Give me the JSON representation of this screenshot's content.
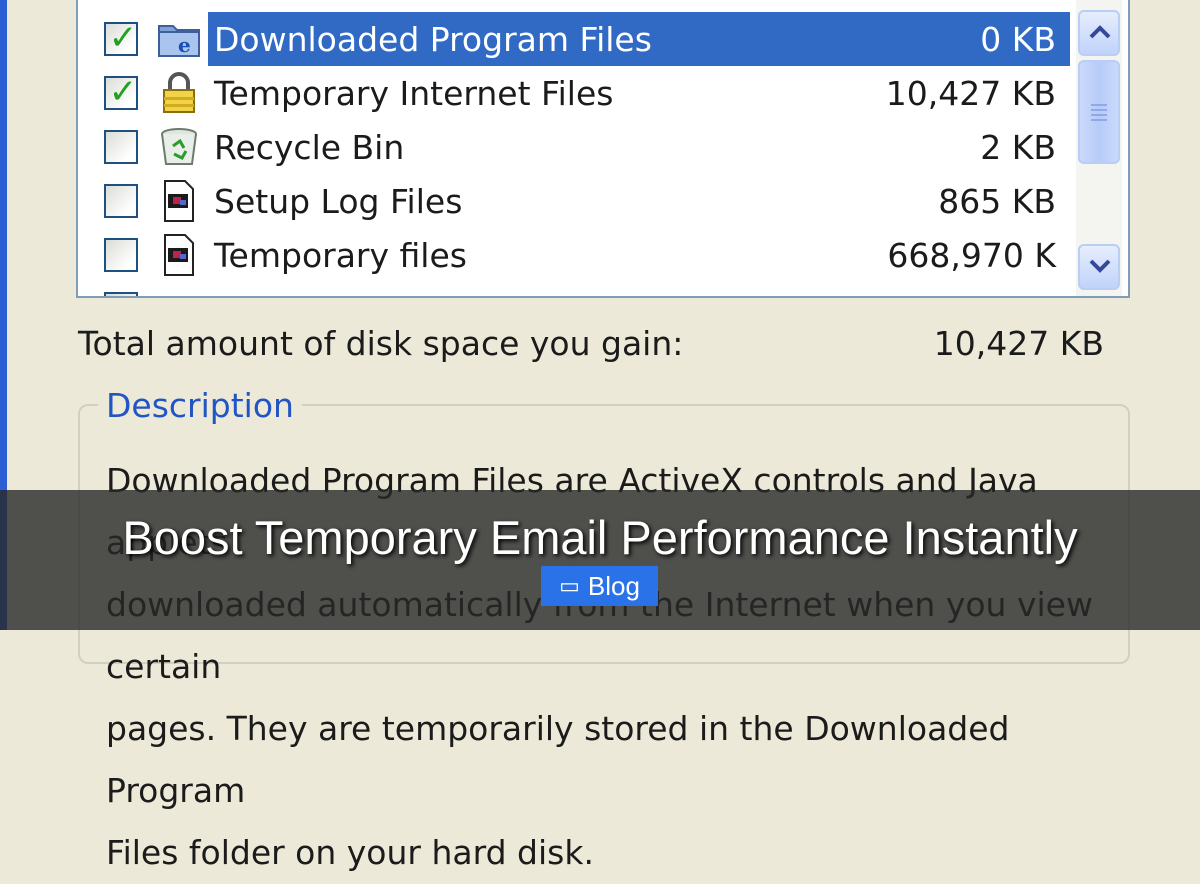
{
  "items": [
    {
      "label": "Downloaded Program Files",
      "size": "0 KB",
      "checked": true,
      "selected": true,
      "icon": "folder-ie-icon"
    },
    {
      "label": "Temporary Internet Files",
      "size": "10,427 KB",
      "checked": true,
      "selected": false,
      "icon": "lock-icon"
    },
    {
      "label": "Recycle Bin",
      "size": "2 KB",
      "checked": false,
      "selected": false,
      "icon": "recycle-bin-icon"
    },
    {
      "label": "Setup Log Files",
      "size": "865 KB",
      "checked": false,
      "selected": false,
      "icon": "document-icon"
    },
    {
      "label": "Temporary files",
      "size": "668,970 K",
      "checked": false,
      "selected": false,
      "icon": "document-icon"
    }
  ],
  "total": {
    "label": "Total amount of disk space you gain:",
    "value": "10,427 KB"
  },
  "description": {
    "title": "Description",
    "lines": [
      "Downloaded Program Files are ActiveX controls and Java applets",
      "downloaded automatically from the Internet when you view certain",
      "pages. They are temporarily stored in the Downloaded Program",
      "Files folder on your hard disk."
    ]
  },
  "overlay": {
    "headline": "Boost Temporary Email Performance Instantly",
    "badge": "Blog",
    "badge_icon": "folder-icon"
  },
  "colors": {
    "selection": "#316ac5",
    "accent_blue": "#2155c4",
    "badge": "#2a72e8"
  }
}
